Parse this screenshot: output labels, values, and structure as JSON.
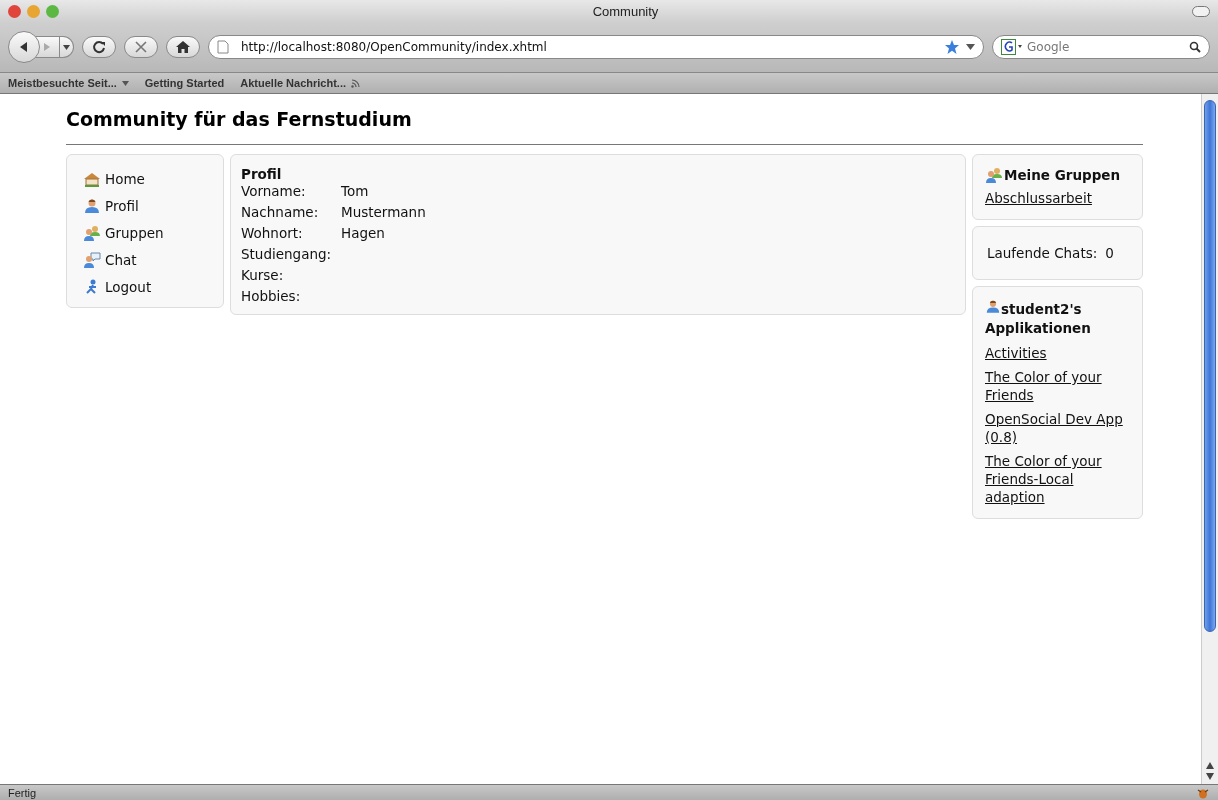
{
  "window": {
    "title": "Community"
  },
  "toolbar": {
    "url": "http://localhost:8080/OpenCommunity/index.xhtml",
    "search_placeholder": "Google"
  },
  "bookmarks": [
    {
      "label": "Meistbesuchte Seit...",
      "kind": "menu"
    },
    {
      "label": "Getting Started",
      "kind": "link"
    },
    {
      "label": "Aktuelle Nachricht...",
      "kind": "feed"
    }
  ],
  "page": {
    "title": "Community für das Fernstudium",
    "nav": [
      {
        "label": "Home",
        "kind": "home"
      },
      {
        "label": "Profil",
        "kind": "person"
      },
      {
        "label": "Gruppen",
        "kind": "group"
      },
      {
        "label": "Chat",
        "kind": "chat"
      },
      {
        "label": "Logout",
        "kind": "logout"
      }
    ],
    "profile": {
      "title": "Profil",
      "fields": [
        {
          "label": "Vorname:",
          "value": "Tom"
        },
        {
          "label": "Nachname:",
          "value": "Mustermann"
        },
        {
          "label": "Wohnort:",
          "value": "Hagen"
        },
        {
          "label": "Studiengang:"
        },
        {
          "label": "Kurse:"
        },
        {
          "label": "Hobbies:"
        }
      ]
    },
    "groups": {
      "title": "Meine Gruppen",
      "items": [
        "Abschlussarbeit"
      ]
    },
    "chats": {
      "label": "Laufende Chats:",
      "count": "0"
    },
    "apps": {
      "title": "student2's Applikationen",
      "items": [
        "Activities",
        "The Color of your Friends",
        "OpenSocial Dev App (0.8)",
        "The Color of your Friends-Local adaption"
      ]
    }
  },
  "status_bar": {
    "text": "Fertig"
  }
}
